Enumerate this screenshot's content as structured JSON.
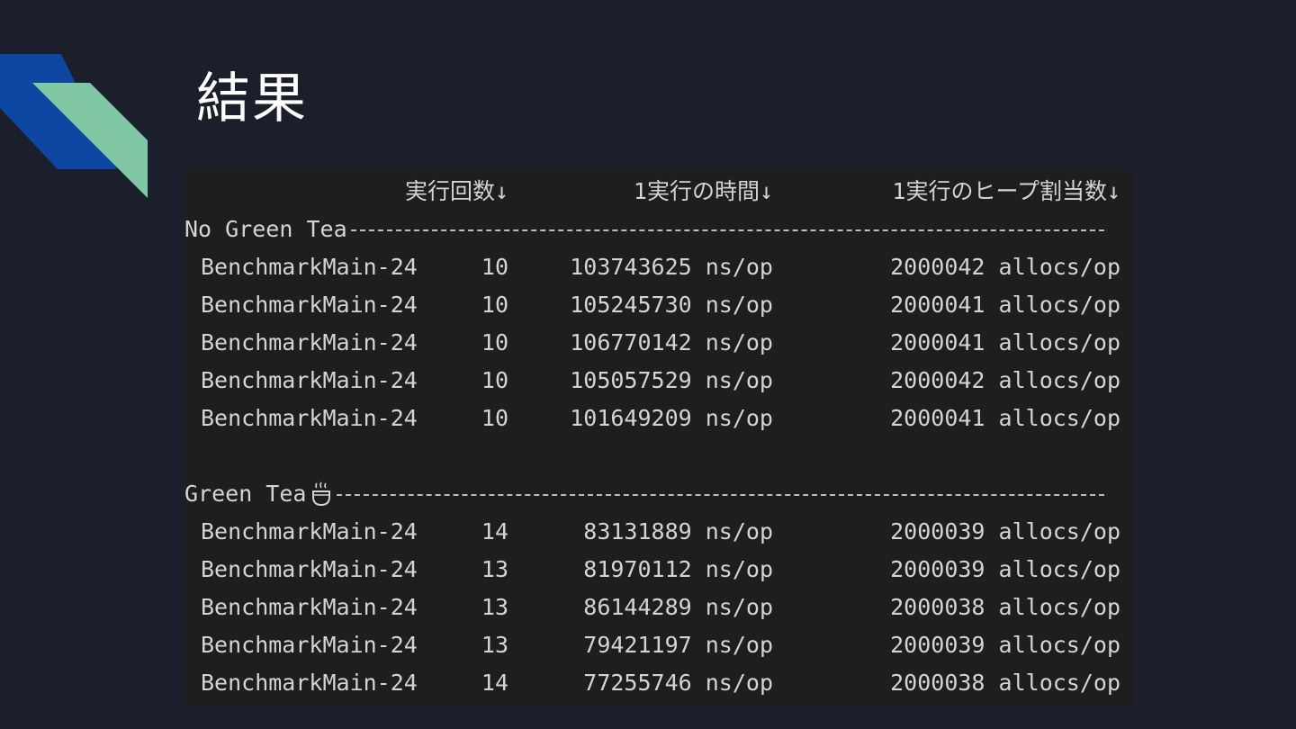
{
  "title": "結果",
  "header": {
    "count": "実行回数↓",
    "time": "1実行の時間↓",
    "allocs": "1実行のヒープ割当数↓"
  },
  "sections": [
    {
      "label": "No Green Tea",
      "rows": [
        {
          "name": "BenchmarkMain-24",
          "n": "10",
          "time": "103743625 ns/op",
          "allocs": "2000042 allocs/op"
        },
        {
          "name": "BenchmarkMain-24",
          "n": "10",
          "time": "105245730 ns/op",
          "allocs": "2000041 allocs/op"
        },
        {
          "name": "BenchmarkMain-24",
          "n": "10",
          "time": "106770142 ns/op",
          "allocs": "2000041 allocs/op"
        },
        {
          "name": "BenchmarkMain-24",
          "n": "10",
          "time": "105057529 ns/op",
          "allocs": "2000042 allocs/op"
        },
        {
          "name": "BenchmarkMain-24",
          "n": "10",
          "time": "101649209 ns/op",
          "allocs": "2000041 allocs/op"
        }
      ]
    },
    {
      "label": "Green Tea",
      "icon": "hot-tea-icon",
      "rows": [
        {
          "name": "BenchmarkMain-24",
          "n": "14",
          "time": "83131889 ns/op",
          "allocs": "2000039 allocs/op"
        },
        {
          "name": "BenchmarkMain-24",
          "n": "13",
          "time": "81970112 ns/op",
          "allocs": "2000039 allocs/op"
        },
        {
          "name": "BenchmarkMain-24",
          "n": "13",
          "time": "86144289 ns/op",
          "allocs": "2000038 allocs/op"
        },
        {
          "name": "BenchmarkMain-24",
          "n": "13",
          "time": "79421197 ns/op",
          "allocs": "2000039 allocs/op"
        },
        {
          "name": "BenchmarkMain-24",
          "n": "14",
          "time": "77255746 ns/op",
          "allocs": "2000038 allocs/op"
        }
      ]
    }
  ],
  "colors": {
    "background": "#1b1f2b",
    "terminal": "#1e1e1e",
    "accent_blue": "#0d47a1",
    "accent_green": "#81c7a5"
  }
}
